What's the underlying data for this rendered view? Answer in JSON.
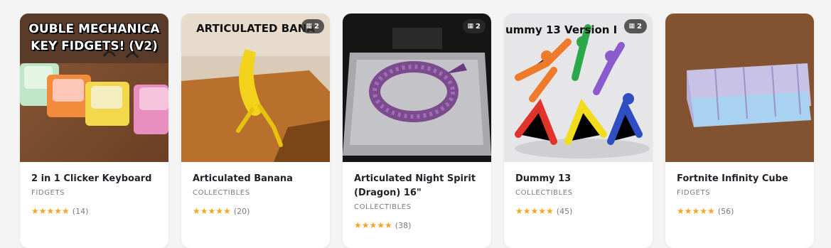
{
  "products": [
    {
      "title": "2 in 1 Clicker Keyboard",
      "category": "FIDGETS",
      "stars": "★★★★★",
      "rating_count": "(14)",
      "image_text_line1": "OUBLE MECHANICA",
      "image_text_line2": "KEY FIDGETS! (V2)",
      "badge": null
    },
    {
      "title": "Articulated Banana",
      "category": "COLLECTIBLES",
      "stars": "★★★★★",
      "rating_count": "(20)",
      "image_text_line1": "ARTICULATED BANA",
      "badge": "2"
    },
    {
      "title": "Articulated Night Spirit (Dragon) 16\"",
      "category": "COLLECTIBLES",
      "stars": "★★★★★",
      "rating_count": "(38)",
      "badge": "2"
    },
    {
      "title": "Dummy 13",
      "category": "COLLECTIBLES",
      "stars": "★★★★★",
      "rating_count": "(45)",
      "image_text_line1": "ummy 13    Version I",
      "badge": "2"
    },
    {
      "title": "Fortnite Infinity Cube",
      "category": "FIDGETS",
      "stars": "★★★★★",
      "rating_count": "(56)",
      "badge": null
    }
  ],
  "badge_icon": "images-icon",
  "colors": {
    "star": "#f5a623",
    "badge_bg": "#2d2d2d"
  }
}
